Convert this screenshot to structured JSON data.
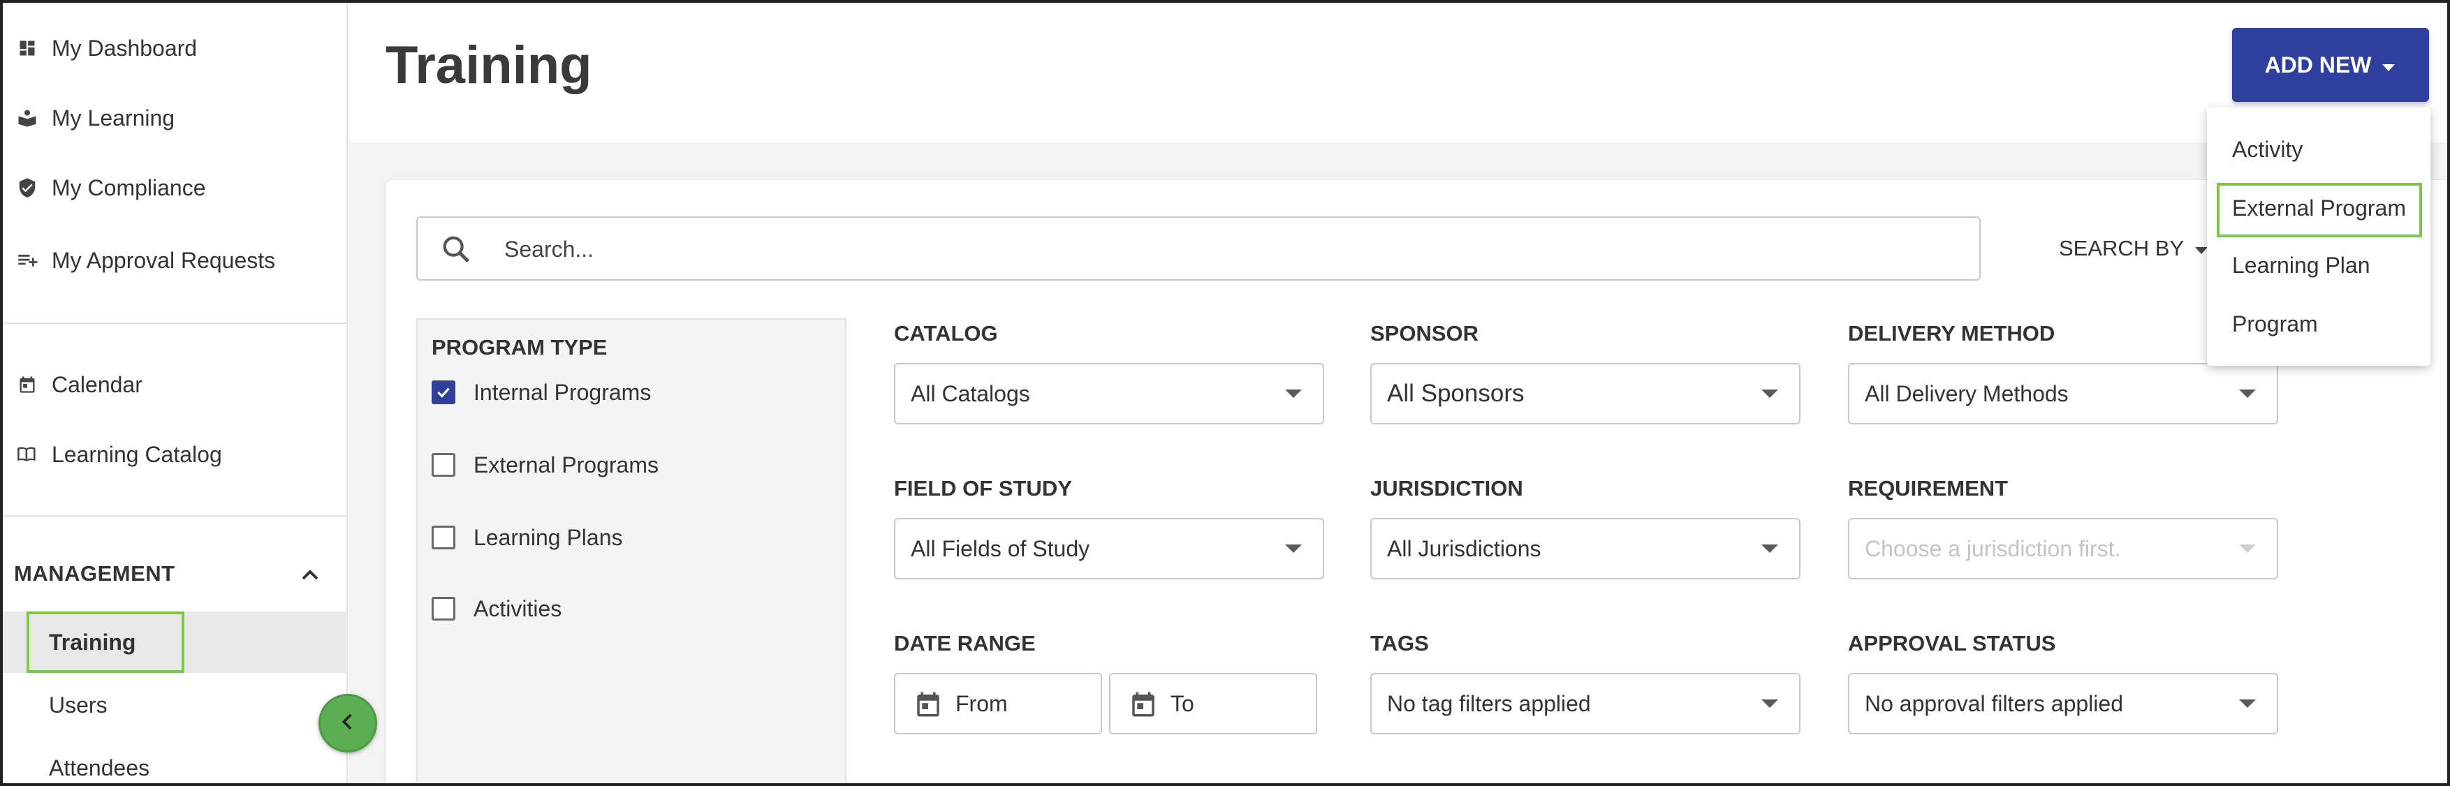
{
  "sidebar": {
    "items": [
      {
        "label": "My Dashboard",
        "icon": "dashboard-icon"
      },
      {
        "label": "My Learning",
        "icon": "learning-icon"
      },
      {
        "label": "My Compliance",
        "icon": "shield-check-icon"
      },
      {
        "label": "My Approval Requests",
        "icon": "playlist-add-icon"
      },
      {
        "label": "Calendar",
        "icon": "calendar-icon"
      },
      {
        "label": "Learning Catalog",
        "icon": "book-open-icon"
      }
    ],
    "management_label": "MANAGEMENT",
    "management_items": [
      {
        "label": "Training"
      },
      {
        "label": "Users"
      },
      {
        "label": "Attendees"
      }
    ]
  },
  "header": {
    "title": "Training",
    "add_new_label": "ADD NEW"
  },
  "search": {
    "placeholder": "Search...",
    "search_by_label": "SEARCH BY"
  },
  "program_type": {
    "title": "PROGRAM TYPE",
    "options": [
      {
        "label": "Internal Programs",
        "checked": true
      },
      {
        "label": "External Programs",
        "checked": false
      },
      {
        "label": "Learning Plans",
        "checked": false
      },
      {
        "label": "Activities",
        "checked": false
      }
    ]
  },
  "filters": {
    "catalog": {
      "label": "CATALOG",
      "value": "All Catalogs"
    },
    "sponsor": {
      "label": "SPONSOR",
      "value": "All Sponsors"
    },
    "delivery_method": {
      "label": "DELIVERY METHOD",
      "value": "All Delivery Methods"
    },
    "field_of_study": {
      "label": "FIELD OF STUDY",
      "value": "All Fields of Study"
    },
    "jurisdiction": {
      "label": "JURISDICTION",
      "value": "All Jurisdictions"
    },
    "requirement": {
      "label": "REQUIREMENT",
      "placeholder": "Choose a jurisdiction first."
    },
    "date_range": {
      "label": "DATE RANGE",
      "from": "From",
      "to": "To"
    },
    "tags": {
      "label": "TAGS",
      "value": "No tag filters applied"
    },
    "approval_status": {
      "label": "APPROVAL STATUS",
      "value": "No approval filters applied"
    }
  },
  "add_new_menu": {
    "items": [
      "Activity",
      "External Program",
      "Learning Plan",
      "Program"
    ]
  },
  "colors": {
    "primary": "#2e3f9c",
    "highlight": "#7bc74a",
    "collapse_button": "#5cae52"
  }
}
